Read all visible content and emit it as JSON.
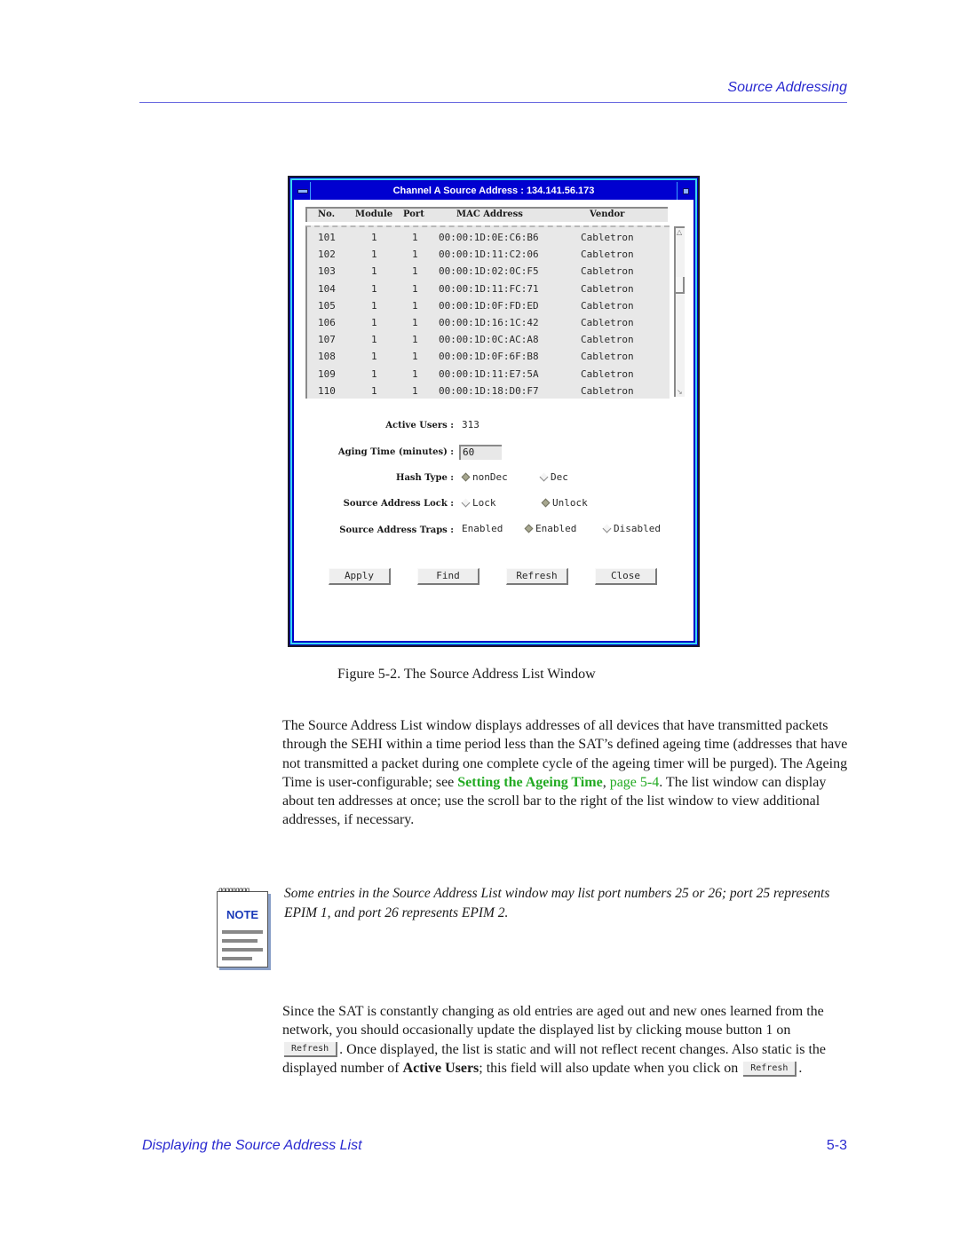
{
  "header": {
    "section_title": "Source Addressing"
  },
  "window": {
    "title": "Channel A Source Address : 134.141.56.173",
    "columns": [
      "No.",
      "Module",
      "Port",
      "MAC Address",
      "Vendor"
    ],
    "rows": [
      {
        "no": "101",
        "module": "1",
        "port": "1",
        "mac": "00:00:1D:0E:C6:B6",
        "vendor": "Cabletron"
      },
      {
        "no": "102",
        "module": "1",
        "port": "1",
        "mac": "00:00:1D:11:C2:06",
        "vendor": "Cabletron"
      },
      {
        "no": "103",
        "module": "1",
        "port": "1",
        "mac": "00:00:1D:02:0C:F5",
        "vendor": "Cabletron"
      },
      {
        "no": "104",
        "module": "1",
        "port": "1",
        "mac": "00:00:1D:11:FC:71",
        "vendor": "Cabletron"
      },
      {
        "no": "105",
        "module": "1",
        "port": "1",
        "mac": "00:00:1D:0F:FD:ED",
        "vendor": "Cabletron"
      },
      {
        "no": "106",
        "module": "1",
        "port": "1",
        "mac": "00:00:1D:16:1C:42",
        "vendor": "Cabletron"
      },
      {
        "no": "107",
        "module": "1",
        "port": "1",
        "mac": "00:00:1D:0C:AC:A8",
        "vendor": "Cabletron"
      },
      {
        "no": "108",
        "module": "1",
        "port": "1",
        "mac": "00:00:1D:0F:6F:B8",
        "vendor": "Cabletron"
      },
      {
        "no": "109",
        "module": "1",
        "port": "1",
        "mac": "00:00:1D:11:E7:5A",
        "vendor": "Cabletron"
      },
      {
        "no": "110",
        "module": "1",
        "port": "1",
        "mac": "00:00:1D:18:D0:F7",
        "vendor": "Cabletron"
      }
    ],
    "fields": {
      "active_users_label": "Active Users :",
      "active_users_value": "313",
      "aging_time_label": "Aging Time (minutes) :",
      "aging_time_value": "60",
      "hash_type_label": "Hash Type :",
      "hash_type_options": [
        "nonDec",
        "Dec"
      ],
      "hash_type_selected": "nonDec",
      "lock_label": "Source Address Lock :",
      "lock_options": [
        "Lock",
        "Unlock"
      ],
      "lock_selected": "Unlock",
      "traps_label": "Source Address Traps :",
      "traps_status": "Enabled",
      "traps_options": [
        "Enabled",
        "Disabled"
      ],
      "traps_selected": "Enabled"
    },
    "buttons": {
      "apply": "Apply",
      "find": "Find",
      "refresh": "Refresh",
      "close": "Close"
    }
  },
  "caption": "Figure 5-2.  The Source Address List Window",
  "body": {
    "para1_before": "The Source Address List window displays addresses of all devices that have transmitted packets through the SEHI within a time period less than the SAT’s defined ageing time (addresses that have not transmitted a packet during one complete cycle of the ageing timer will be purged). The Ageing Time is user-configurable; see ",
    "para1_link": "Setting the Ageing Time",
    "para1_sep": ", ",
    "para1_page_link": "page 5-4",
    "para1_after": ". The list window can display about ten addresses at once; use the scroll bar to the right of the list window to view additional addresses, if necessary.",
    "note_label": "NOTE",
    "note_text": "Some entries in the Source Address List window may list port numbers 25 or 26; port 25 represents EPIM 1, and port 26 represents EPIM 2.",
    "para2_part1": "Since the SAT is constantly changing as old entries are aged out and new ones learned from the network, you should occasionally update the displayed list by clicking mouse button 1 on ",
    "para2_button": "Refresh",
    "para2_part2": ". Once displayed, the list is static and will not reflect recent changes. Also static is the displayed number of ",
    "para2_bold": "Active Users",
    "para2_part3": "; this field will also update when you click on ",
    "para2_part4": "."
  },
  "footer": {
    "title": "Displaying the Source Address List",
    "page": "5-3"
  },
  "colors": {
    "link_blue": "#2a2ad0",
    "link_green": "#22aa22",
    "window_blue": "#0000c8"
  }
}
